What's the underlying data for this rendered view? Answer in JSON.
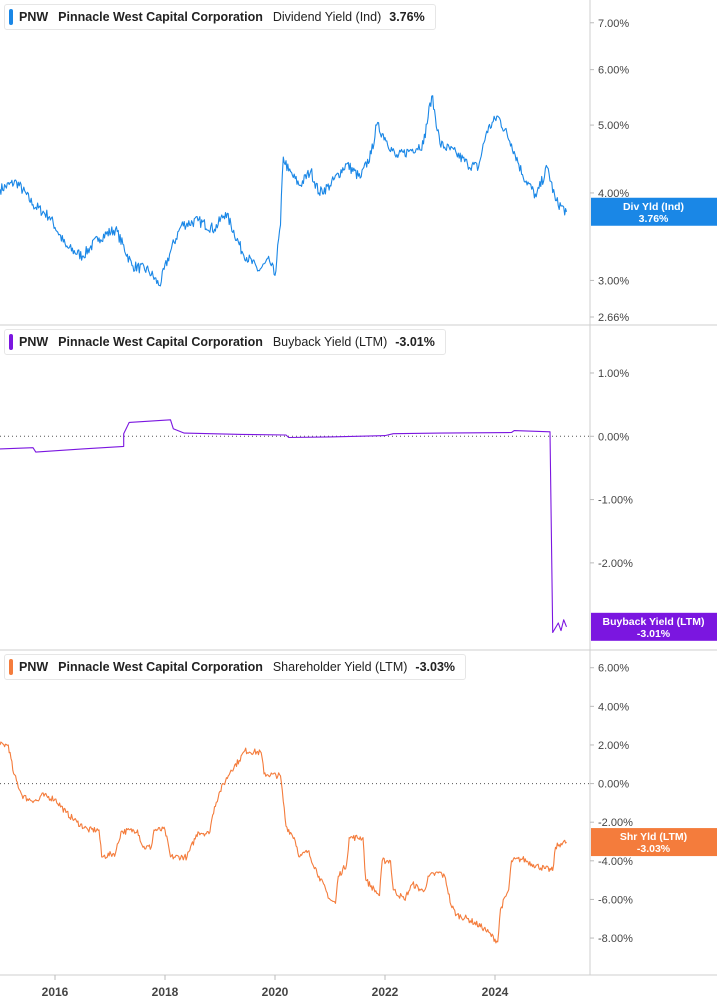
{
  "chart_data": [
    {
      "type": "line",
      "ticker": "PNW",
      "company": "Pinnacle West Capital Corporation",
      "metric": "Dividend Yield (Ind)",
      "current_label": "3.76%",
      "flag_label": [
        "Div Yld (Ind)",
        "3.76%"
      ],
      "color": "#1a87e6",
      "scale": "log",
      "ylim": [
        2.66,
        7.3
      ],
      "yticks": [
        {
          "v": 7,
          "t": "7.00%"
        },
        {
          "v": 6,
          "t": "6.00%"
        },
        {
          "v": 5,
          "t": "5.00%"
        },
        {
          "v": 4,
          "t": "4.00%"
        },
        {
          "v": 3,
          "t": "3.00%"
        },
        {
          "v": 2.66,
          "t": "2.66%"
        }
      ],
      "points": [
        [
          2015.0,
          4.05
        ],
        [
          2015.3,
          4.15
        ],
        [
          2015.6,
          3.85
        ],
        [
          2015.9,
          3.7
        ],
        [
          2016.2,
          3.35
        ],
        [
          2016.5,
          3.25
        ],
        [
          2016.8,
          3.45
        ],
        [
          2017.1,
          3.55
        ],
        [
          2017.4,
          3.15
        ],
        [
          2017.7,
          3.1
        ],
        [
          2017.9,
          2.95
        ],
        [
          2018.1,
          3.3
        ],
        [
          2018.3,
          3.6
        ],
        [
          2018.6,
          3.65
        ],
        [
          2018.9,
          3.55
        ],
        [
          2019.1,
          3.75
        ],
        [
          2019.4,
          3.3
        ],
        [
          2019.7,
          3.1
        ],
        [
          2019.9,
          3.2
        ],
        [
          2020.0,
          3.05
        ],
        [
          2020.1,
          3.6
        ],
        [
          2020.15,
          4.5
        ],
        [
          2020.25,
          4.3
        ],
        [
          2020.45,
          4.1
        ],
        [
          2020.65,
          4.3
        ],
        [
          2020.8,
          4.0
        ],
        [
          2021.0,
          4.1
        ],
        [
          2021.3,
          4.4
        ],
        [
          2021.55,
          4.2
        ],
        [
          2021.75,
          4.55
        ],
        [
          2021.85,
          5.0
        ],
        [
          2022.0,
          4.8
        ],
        [
          2022.2,
          4.5
        ],
        [
          2022.45,
          4.6
        ],
        [
          2022.7,
          4.7
        ],
        [
          2022.85,
          5.5
        ],
        [
          2023.0,
          4.7
        ],
        [
          2023.3,
          4.55
        ],
        [
          2023.5,
          4.4
        ],
        [
          2023.7,
          4.35
        ],
        [
          2023.85,
          4.9
        ],
        [
          2024.05,
          5.15
        ],
        [
          2024.3,
          4.7
        ],
        [
          2024.5,
          4.25
        ],
        [
          2024.75,
          3.95
        ],
        [
          2024.95,
          4.35
        ],
        [
          2025.1,
          3.9
        ],
        [
          2025.3,
          3.76
        ]
      ]
    },
    {
      "type": "line",
      "ticker": "PNW",
      "company": "Pinnacle West Capital Corporation",
      "metric": "Buyback Yield (LTM)",
      "current_label": "-3.01%",
      "flag_label": [
        "Buyback Yield (LTM)",
        "-3.01%"
      ],
      "color": "#7b16e0",
      "ylim": [
        -3.25,
        1.6
      ],
      "yticks": [
        {
          "v": 1,
          "t": "1.00%"
        },
        {
          "v": 0,
          "t": "0.00%"
        },
        {
          "v": -1,
          "t": "-1.00%"
        },
        {
          "v": -2,
          "t": "-2.00%"
        }
      ],
      "zero_line": 0,
      "points": [
        [
          2015.0,
          -0.2
        ],
        [
          2015.6,
          -0.18
        ],
        [
          2015.65,
          -0.25
        ],
        [
          2016.5,
          -0.2
        ],
        [
          2017.25,
          -0.16
        ],
        [
          2017.25,
          0.04
        ],
        [
          2017.35,
          0.22
        ],
        [
          2018.1,
          0.26
        ],
        [
          2018.15,
          0.12
        ],
        [
          2018.35,
          0.05
        ],
        [
          2019.4,
          0.03
        ],
        [
          2020.2,
          0.02
        ],
        [
          2020.25,
          -0.02
        ],
        [
          2021.0,
          -0.01
        ],
        [
          2022.0,
          0.01
        ],
        [
          2022.15,
          0.04
        ],
        [
          2023.0,
          0.05
        ],
        [
          2024.3,
          0.06
        ],
        [
          2024.35,
          0.09
        ],
        [
          2025.0,
          0.07
        ],
        [
          2025.05,
          -3.1
        ],
        [
          2025.15,
          -2.95
        ],
        [
          2025.2,
          -3.07
        ],
        [
          2025.25,
          -2.9
        ],
        [
          2025.3,
          -3.01
        ]
      ]
    },
    {
      "type": "line",
      "ticker": "PNW",
      "company": "Pinnacle West Capital Corporation",
      "metric": "Shareholder Yield (LTM)",
      "current_label": "-3.03%",
      "flag_label": [
        "Shr Yld (LTM)",
        "-3.03%"
      ],
      "color": "#f47c3c",
      "ylim": [
        -9.5,
        6.4
      ],
      "yticks": [
        {
          "v": 6,
          "t": "6.00%"
        },
        {
          "v": 4,
          "t": "4.00%"
        },
        {
          "v": 2,
          "t": "2.00%"
        },
        {
          "v": 0,
          "t": "0.00%"
        },
        {
          "v": -2,
          "t": "-2.00%"
        },
        {
          "v": -4,
          "t": "-4.00%"
        },
        {
          "v": -6,
          "t": "-6.00%"
        },
        {
          "v": -8,
          "t": "-8.00%"
        }
      ],
      "zero_line": 0,
      "points": [
        [
          2015.0,
          2.0
        ],
        [
          2015.15,
          2.0
        ],
        [
          2015.25,
          0.5
        ],
        [
          2015.4,
          -0.6
        ],
        [
          2015.5,
          -0.8
        ],
        [
          2015.7,
          -0.9
        ],
        [
          2015.75,
          -0.6
        ],
        [
          2016.0,
          -0.8
        ],
        [
          2016.2,
          -1.5
        ],
        [
          2016.4,
          -2.0
        ],
        [
          2016.6,
          -2.4
        ],
        [
          2016.8,
          -2.4
        ],
        [
          2016.85,
          -3.8
        ],
        [
          2017.1,
          -3.6
        ],
        [
          2017.2,
          -2.5
        ],
        [
          2017.5,
          -2.4
        ],
        [
          2017.6,
          -3.3
        ],
        [
          2017.75,
          -3.3
        ],
        [
          2017.8,
          -2.4
        ],
        [
          2018.0,
          -2.4
        ],
        [
          2018.1,
          -3.8
        ],
        [
          2018.4,
          -3.8
        ],
        [
          2018.6,
          -2.5
        ],
        [
          2018.8,
          -2.6
        ],
        [
          2018.9,
          -1.2
        ],
        [
          2019.0,
          -0.4
        ],
        [
          2019.2,
          0.7
        ],
        [
          2019.35,
          1.2
        ],
        [
          2019.45,
          1.7
        ],
        [
          2019.75,
          1.6
        ],
        [
          2019.8,
          0.5
        ],
        [
          2020.1,
          0.4
        ],
        [
          2020.2,
          -2.2
        ],
        [
          2020.35,
          -2.8
        ],
        [
          2020.45,
          -3.8
        ],
        [
          2020.6,
          -3.5
        ],
        [
          2020.8,
          -4.8
        ],
        [
          2021.0,
          -6.0
        ],
        [
          2021.1,
          -6.2
        ],
        [
          2021.15,
          -4.8
        ],
        [
          2021.3,
          -4.2
        ],
        [
          2021.35,
          -2.8
        ],
        [
          2021.6,
          -2.8
        ],
        [
          2021.65,
          -5.0
        ],
        [
          2021.9,
          -5.8
        ],
        [
          2021.95,
          -4.0
        ],
        [
          2022.1,
          -4.0
        ],
        [
          2022.15,
          -5.5
        ],
        [
          2022.35,
          -6.0
        ],
        [
          2022.5,
          -5.2
        ],
        [
          2022.7,
          -5.6
        ],
        [
          2022.8,
          -4.8
        ],
        [
          2023.0,
          -4.6
        ],
        [
          2023.1,
          -4.9
        ],
        [
          2023.2,
          -6.3
        ],
        [
          2023.3,
          -6.8
        ],
        [
          2023.5,
          -7.0
        ],
        [
          2023.8,
          -7.5
        ],
        [
          2024.05,
          -8.2
        ],
        [
          2024.1,
          -6.5
        ],
        [
          2024.25,
          -5.5
        ],
        [
          2024.3,
          -4.0
        ],
        [
          2024.5,
          -3.9
        ],
        [
          2024.7,
          -4.2
        ],
        [
          2024.9,
          -4.4
        ],
        [
          2025.05,
          -4.5
        ],
        [
          2025.1,
          -3.3
        ],
        [
          2025.2,
          -3.1
        ],
        [
          2025.3,
          -3.03
        ]
      ]
    }
  ],
  "x_axis": {
    "ticks": [
      {
        "v": 2016,
        "t": "2016"
      },
      {
        "v": 2018,
        "t": "2018"
      },
      {
        "v": 2020,
        "t": "2020"
      },
      {
        "v": 2022,
        "t": "2022"
      },
      {
        "v": 2024,
        "t": "2024"
      }
    ],
    "range": [
      2015.0,
      2025.4
    ]
  }
}
